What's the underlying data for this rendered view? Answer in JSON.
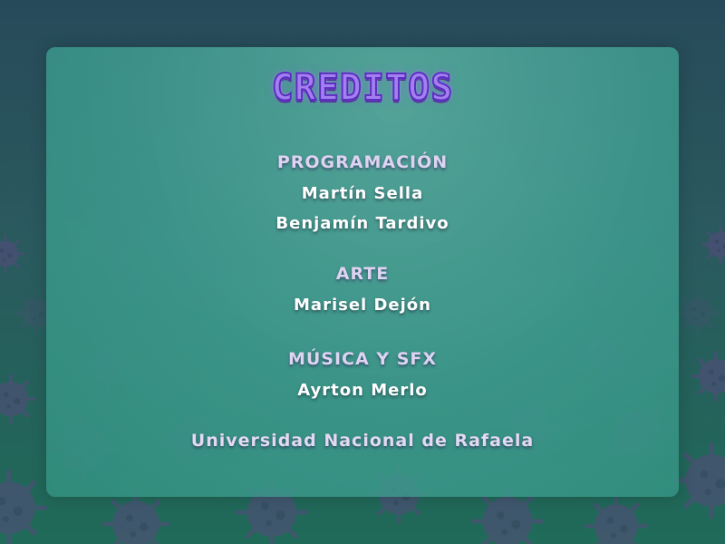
{
  "title": "CREDITOS",
  "sections": [
    {
      "heading": "PROGRAMACIÓN",
      "names": [
        "Martín Sella",
        "Benjamín Tardivo"
      ]
    },
    {
      "heading": "ARTE",
      "names": [
        "Marisel Dejón"
      ]
    },
    {
      "heading": "MÚSICA Y SFX",
      "names": [
        "Ayrton Merlo"
      ]
    }
  ],
  "footer": "Universidad Nacional de Rafaela",
  "colors": {
    "background_top": "#274a5a",
    "background_bottom": "#1f6a58",
    "panel": "#45a596",
    "title_fill": "#a47ff0",
    "title_outline": "#5a2fc0",
    "heading_text": "#ded4f2",
    "name_text": "#ffffff",
    "virus": "#5a4a7e"
  },
  "decor_icon": "virus-icon"
}
